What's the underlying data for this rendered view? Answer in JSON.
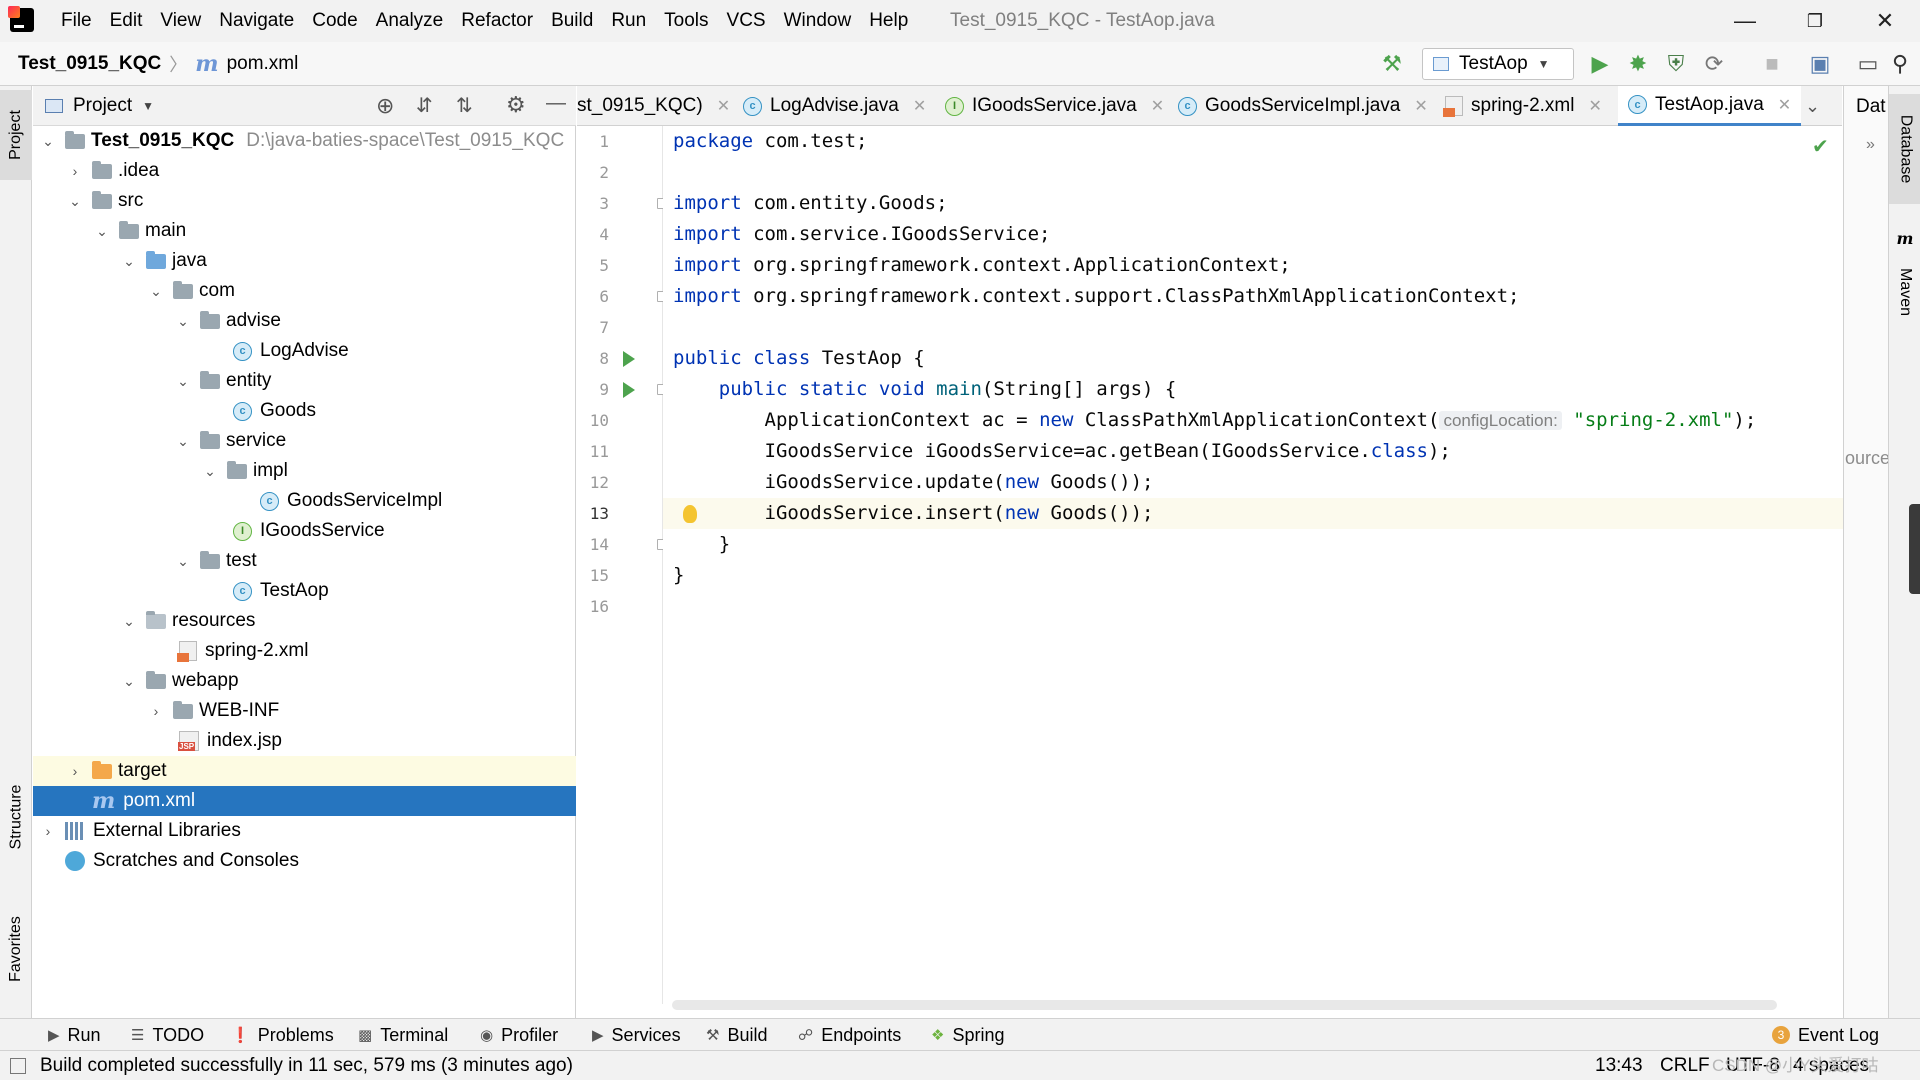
{
  "app": {
    "window_title": "Test_0915_KQC - TestAop.java",
    "menu": [
      "File",
      "Edit",
      "View",
      "Navigate",
      "Code",
      "Analyze",
      "Refactor",
      "Build",
      "Run",
      "Tools",
      "VCS",
      "Window",
      "Help"
    ]
  },
  "navbar": {
    "project": "Test_0915_KQC",
    "file": "pom.xml",
    "run_config": "TestAop"
  },
  "project_panel": {
    "title": "Project",
    "tree": [
      {
        "label": "Test_0915_KQC",
        "path": "D:\\java-baties-space\\Test_0915_KQC",
        "level": 0,
        "expanded": true,
        "icon": "module-folder",
        "bold": true
      },
      {
        "label": ".idea",
        "level": 1,
        "expanded": false,
        "icon": "folder"
      },
      {
        "label": "src",
        "level": 1,
        "expanded": true,
        "icon": "folder"
      },
      {
        "label": "main",
        "level": 2,
        "expanded": true,
        "icon": "folder"
      },
      {
        "label": "java",
        "level": 3,
        "expanded": true,
        "icon": "source-folder"
      },
      {
        "label": "com",
        "level": 4,
        "expanded": true,
        "icon": "package"
      },
      {
        "label": "advise",
        "level": 5,
        "expanded": true,
        "icon": "package"
      },
      {
        "label": "LogAdvise",
        "level": 6,
        "icon": "class"
      },
      {
        "label": "entity",
        "level": 5,
        "expanded": true,
        "icon": "package"
      },
      {
        "label": "Goods",
        "level": 6,
        "icon": "class"
      },
      {
        "label": "service",
        "level": 5,
        "expanded": true,
        "icon": "package"
      },
      {
        "label": "impl",
        "level": 6,
        "expanded": true,
        "icon": "package"
      },
      {
        "label": "GoodsServiceImpl",
        "level": 7,
        "icon": "class"
      },
      {
        "label": "IGoodsService",
        "level": 6,
        "icon": "interface"
      },
      {
        "label": "test",
        "level": 5,
        "expanded": true,
        "icon": "package"
      },
      {
        "label": "TestAop",
        "level": 6,
        "icon": "class-runnable"
      },
      {
        "label": "resources",
        "level": 3,
        "expanded": true,
        "icon": "resources-folder"
      },
      {
        "label": "spring-2.xml",
        "level": 4,
        "icon": "xml"
      },
      {
        "label": "webapp",
        "level": 3,
        "expanded": true,
        "icon": "web-folder"
      },
      {
        "label": "WEB-INF",
        "level": 4,
        "expanded": false,
        "icon": "folder"
      },
      {
        "label": "index.jsp",
        "level": 4,
        "icon": "jsp"
      },
      {
        "label": "target",
        "level": 1,
        "expanded": false,
        "icon": "excluded-folder",
        "highlight": true
      },
      {
        "label": "pom.xml",
        "level": 1,
        "icon": "maven",
        "selected": true
      },
      {
        "label": "External Libraries",
        "level": 0,
        "expanded": false,
        "icon": "library"
      },
      {
        "label": "Scratches and Consoles",
        "level": 0,
        "icon": "scratches"
      }
    ]
  },
  "editor": {
    "tabs": [
      {
        "label": "st_0915_KQC)",
        "icon": "none"
      },
      {
        "label": "LogAdvise.java",
        "icon": "class"
      },
      {
        "label": "IGoodsService.java",
        "icon": "interface"
      },
      {
        "label": "GoodsServiceImpl.java",
        "icon": "class"
      },
      {
        "label": "spring-2.xml",
        "icon": "xml"
      },
      {
        "label": "TestAop.java",
        "icon": "class-runnable",
        "active": true
      }
    ],
    "line_numbers": [
      "1",
      "2",
      "3",
      "4",
      "5",
      "6",
      "7",
      "8",
      "9",
      "10",
      "11",
      "12",
      "13",
      "14",
      "15",
      "16"
    ],
    "current_line": 13,
    "code": {
      "l1_kw": "package",
      "l1_rest": " com.test;",
      "l3_kw": "import",
      "l3_rest": " com.entity.Goods;",
      "l4_kw": "import",
      "l4_rest": " com.service.IGoodsService;",
      "l5_kw": "import",
      "l5_rest": " org.springframework.context.ApplicationContext;",
      "l6_kw": "import",
      "l6_rest": " org.springframework.context.support.ClassPathXmlApplicationContext;",
      "l8_kw": "public class",
      "l8_rest": " TestAop {",
      "l9_kw": "public static void",
      "l9_mth": "main",
      "l9_rest": "(String[] args) {",
      "l10_a": "ApplicationContext ac = ",
      "l10_kw": "new",
      "l10_b": " ClassPathXmlApplicationContext(",
      "l10_hint": "configLocation:",
      "l10_str": "\"spring-2.xml\"",
      "l10_c": ");",
      "l11_a": "IGoodsService iGoodsService=ac.getBean(IGoodsService.",
      "l11_kw": "class",
      "l11_c": ");",
      "l12_a": "iGoodsService.update(",
      "l12_kw": "new",
      "l12_c": " Goods());",
      "l13_a": "iGoodsService.insert(",
      "l13_kw": "new",
      "l13_c": " Goods());",
      "l14": "}",
      "l15": "}"
    },
    "overflow_text": "ource"
  },
  "left_stripe": {
    "project": "Project",
    "structure": "Structure",
    "favorites": "Favorites"
  },
  "right_stripe": {
    "database": "Database",
    "maven": "Maven",
    "database_short": "Dat"
  },
  "bottom_tools": [
    "Run",
    "TODO",
    "Problems",
    "Terminal",
    "Profiler",
    "Services",
    "Build",
    "Endpoints",
    "Spring"
  ],
  "event_log": {
    "label": "Event Log",
    "count": "3"
  },
  "status": {
    "message": "Build completed successfully in 11 sec, 579 ms (3 minutes ago)",
    "position": "13:43",
    "line_sep": "CRLF",
    "encoding": "UTF-8",
    "indent": "4 spaces",
    "watermark": "CSDN @小Y头爱打咕"
  },
  "colors": {
    "accent": "#2675bf",
    "keyword": "#0033b3",
    "string": "#067d17",
    "run_green": "#4da34d",
    "current_line": "#fcfaed"
  }
}
